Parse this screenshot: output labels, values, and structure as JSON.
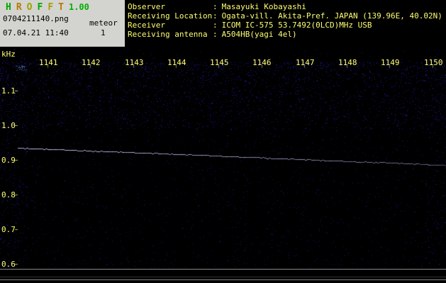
{
  "app": {
    "title_letters": [
      {
        "ch": "H",
        "color": "#00a800"
      },
      {
        "ch": "R",
        "color": "#b87800"
      },
      {
        "ch": "O",
        "color": "#a0a000"
      },
      {
        "ch": "F",
        "color": "#00a800"
      },
      {
        "ch": "F",
        "color": "#a0a000"
      },
      {
        "ch": "T",
        "color": "#b87800"
      }
    ],
    "version": "1.00",
    "version_color": "#00b000",
    "filename": "0704211140.png",
    "mode": "meteor",
    "datetime": "07.04.21 11:40",
    "count": "1"
  },
  "station": {
    "colon": ":",
    "rows": [
      {
        "label": "Observer",
        "value": "Masayuki Kobayashi"
      },
      {
        "label": "Receiving Location",
        "value": "Ogata-vill. Akita-Pref. JAPAN (139.96E, 40.02N)"
      },
      {
        "label": "Receiver",
        "value": "ICOM IC-575 53.7492(0LCD)MHz USB"
      },
      {
        "label": "Receiving antenna",
        "value": "A504HB(yagi 4el)"
      }
    ]
  },
  "spectrogram": {
    "unit_label": "kHz",
    "freq_ticks": [
      "1.1",
      "1.0",
      "0.9",
      "0.8",
      "0.7",
      "0.6"
    ],
    "time_ticks": [
      "1141",
      "1142",
      "1143",
      "1144",
      "1145",
      "1146",
      "1147",
      "1148",
      "1149",
      "1150"
    ],
    "trace": {
      "start_khz": 0.935,
      "end_khz": 0.885
    },
    "colors": {
      "label": "#ffff72",
      "noise_rgb": "45,45,255",
      "bright_rgb": "120,160,255",
      "trace_rgb": "190,190,240",
      "freq_tick": "#b8b830",
      "time_tick": "#777777"
    }
  }
}
